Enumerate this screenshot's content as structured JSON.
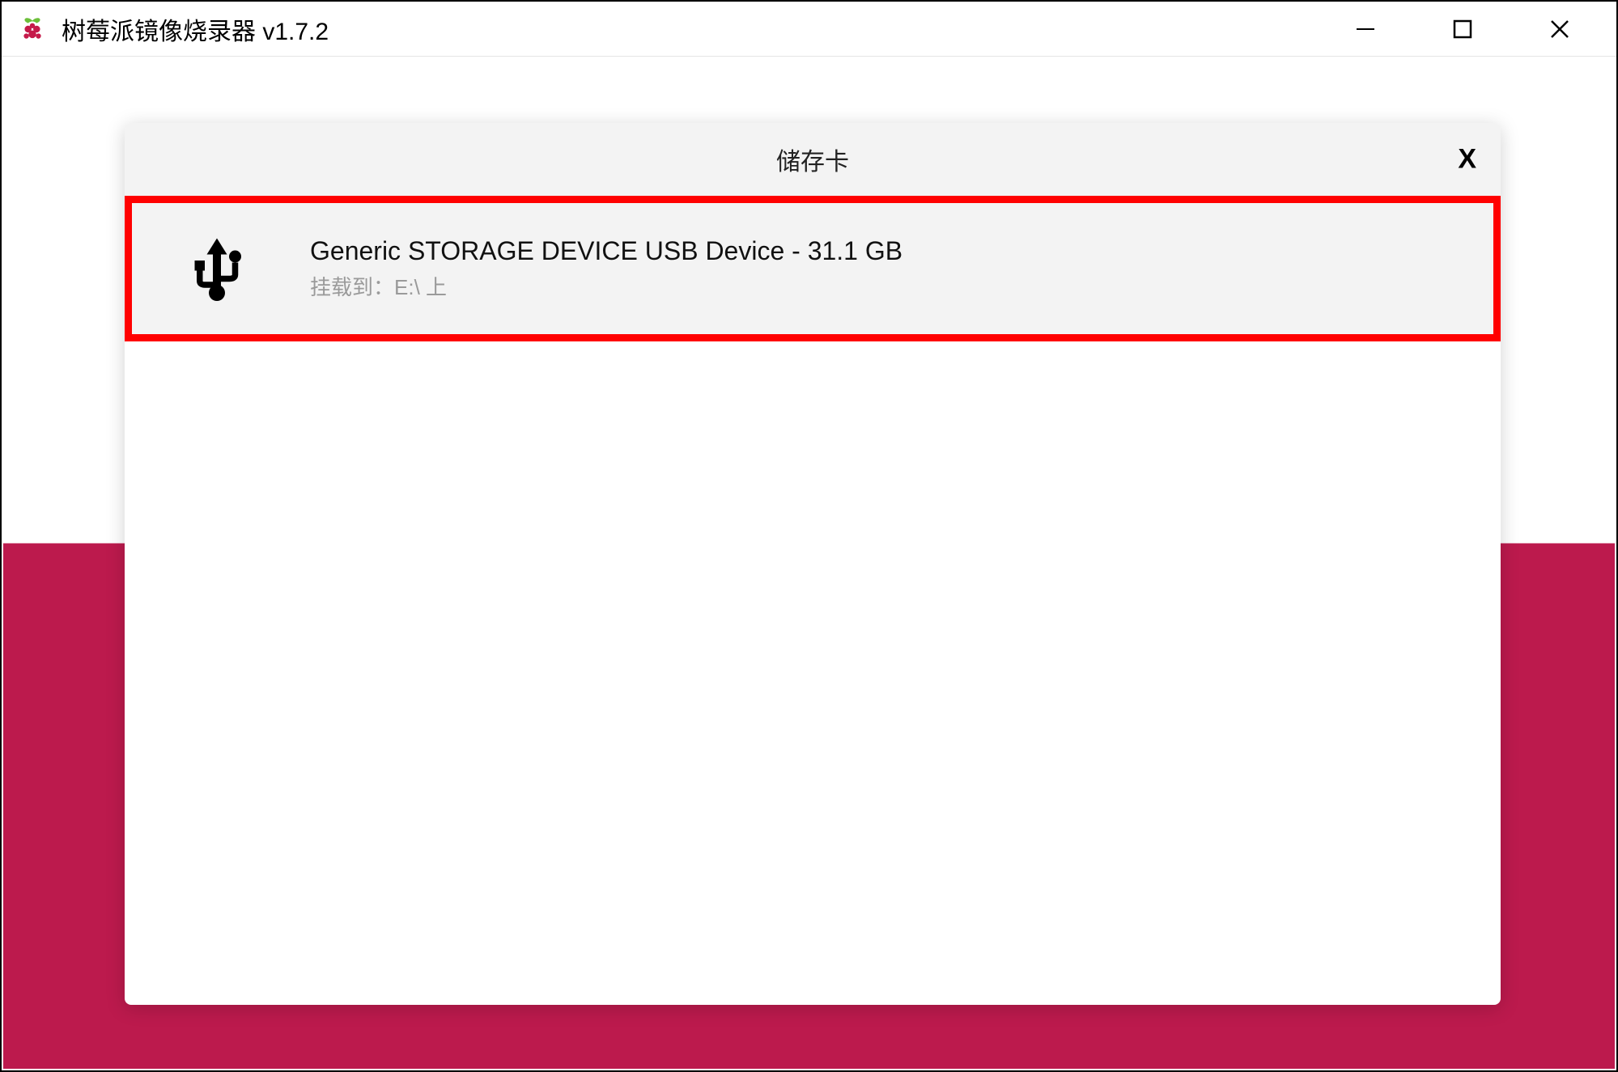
{
  "window": {
    "title": "树莓派镜像烧录器 v1.7.2"
  },
  "dialog": {
    "title": "储存卡",
    "close_label": "X",
    "device": {
      "name": "Generic STORAGE DEVICE USB Device - 31.1 GB",
      "mount": "挂载到：E:\\ 上"
    }
  },
  "colors": {
    "accent": "#bc1a4d",
    "highlight_border": "#ff0000"
  }
}
